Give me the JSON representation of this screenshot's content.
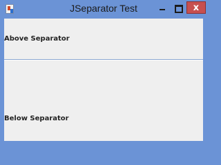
{
  "window": {
    "title": "JSeparator Test",
    "close_glyph": "x",
    "icons": {
      "app": "java-app-icon",
      "minimize": "minimize-icon",
      "maximize": "maximize-icon",
      "close": "close-icon"
    }
  },
  "content": {
    "above_label": "Above Separator",
    "below_label": "Below Separator"
  },
  "colors": {
    "frame": "#6b93d6",
    "content_bg": "#efefef",
    "close_bg": "#c75050",
    "separator": "#8aa6d0"
  }
}
